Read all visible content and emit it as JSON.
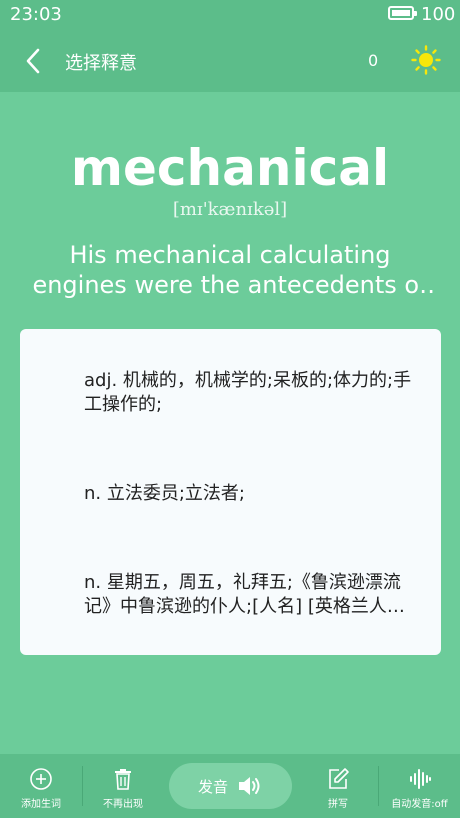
{
  "status": {
    "time": "23:03",
    "battery": "100"
  },
  "header": {
    "title": "选择释意",
    "count": "0"
  },
  "word": {
    "text": "mechanical",
    "phonetic": "[mɪ'kænɪkəl]",
    "example": "His mechanical calculating engines were the antecedents of the modern computer."
  },
  "meanings": [
    {
      "text": "adj.  机械的，机械学的;呆板的;体力的;手工操作的;"
    },
    {
      "text": "n.  立法委员;立法者;"
    },
    {
      "text": "n.  星期五，周五，礼拜五;《鲁滨逊漂流记》中鲁滨逊的仆人;[人名] [英格兰人姓氏]"
    }
  ],
  "toolbar": {
    "add_word": "添加生词",
    "no_show": "不再出现",
    "speak": "发音",
    "spell": "拼写",
    "auto_speak": "自动发音:off"
  },
  "colors": {
    "background": "#6ccc9a",
    "bar": "#5cbd8a",
    "sun": "#f7e70a"
  }
}
